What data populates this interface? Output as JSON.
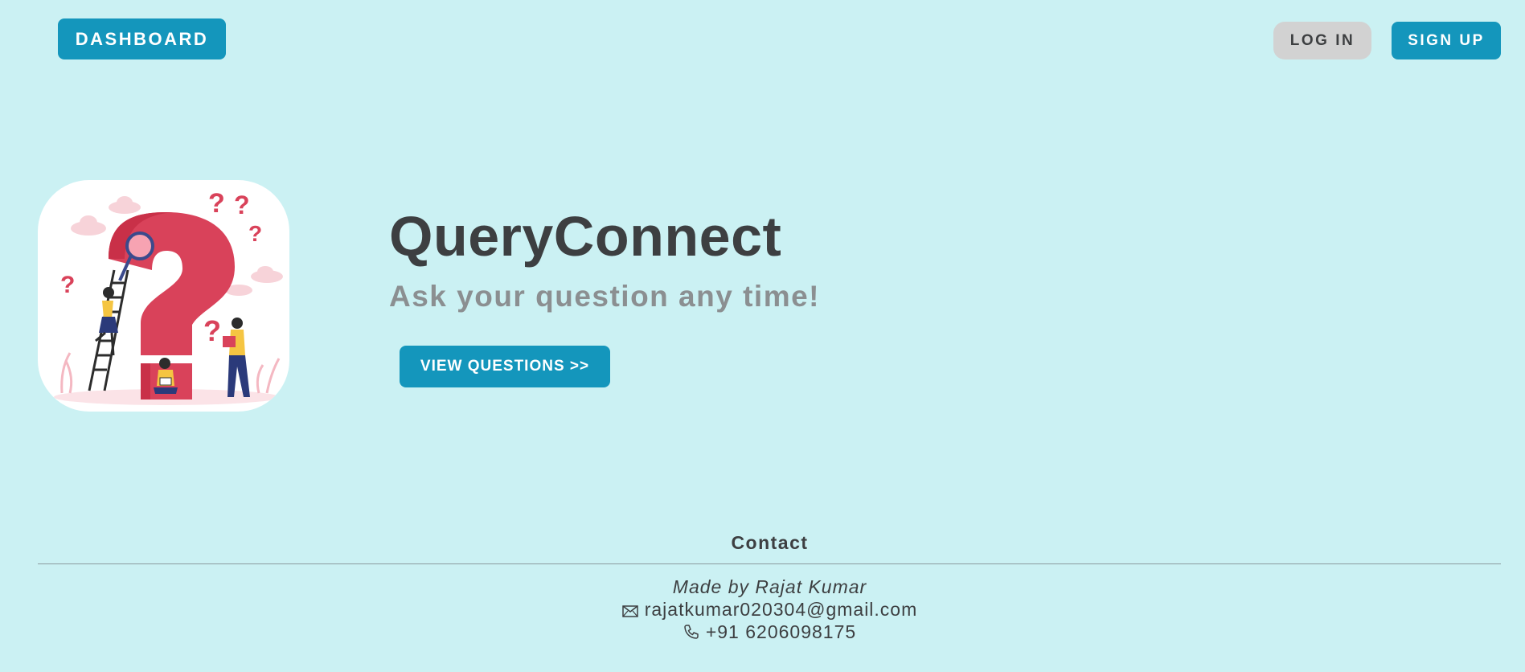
{
  "nav": {
    "dashboard_label": "DASHBOARD",
    "login_label": "LOG IN",
    "signup_label": "SIGN UP"
  },
  "hero": {
    "title": "QueryConnect",
    "subtitle": "Ask your question any time!",
    "cta_label": "VIEW QUESTIONS >>",
    "illustration": "question-mark-illustration"
  },
  "footer": {
    "heading": "Contact",
    "made_by": "Made by Rajat Kumar",
    "email": "rajatkumar020304@gmail.com",
    "phone": "+91 6206098175",
    "email_icon": "envelope-icon",
    "phone_icon": "phone-icon"
  },
  "colors": {
    "background": "#cbf1f3",
    "primary": "#1496bc",
    "secondary_button": "#d2d2d2",
    "text_dark": "#3d3f41",
    "text_muted": "#8b8f91",
    "accent_red": "#d9425a"
  }
}
